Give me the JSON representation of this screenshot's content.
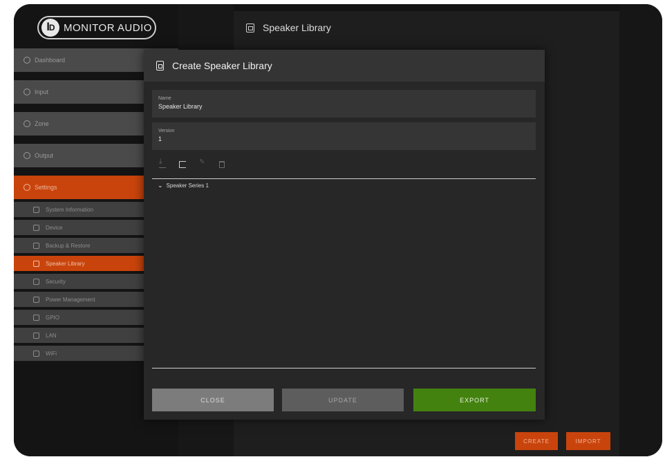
{
  "brand": {
    "logo_text": "MONITOR AUDIO",
    "accent_color": "#c9440c",
    "success_color": "#44820f"
  },
  "page_title": "Speaker Library",
  "nav": [
    {
      "label": "Dashboard",
      "icon": "dashboard-icon",
      "active": false
    },
    {
      "label": "Input",
      "icon": "input-icon",
      "active": false
    },
    {
      "label": "Zone",
      "icon": "zone-icon",
      "active": false
    },
    {
      "label": "Output",
      "icon": "output-icon",
      "active": false
    },
    {
      "label": "Settings",
      "icon": "settings-icon",
      "active": true
    }
  ],
  "settings_items": [
    {
      "label": "System Information",
      "icon": "info-icon",
      "active": false
    },
    {
      "label": "Device",
      "icon": "device-icon",
      "active": false
    },
    {
      "label": "Backup & Restore",
      "icon": "backup-icon",
      "active": false
    },
    {
      "label": "Speaker Library",
      "icon": "speaker-library-icon",
      "active": true
    },
    {
      "label": "Security",
      "icon": "security-icon",
      "active": false
    },
    {
      "label": "Power Management",
      "icon": "power-icon",
      "active": false
    },
    {
      "label": "GPIO",
      "icon": "gpio-icon",
      "active": false
    },
    {
      "label": "LAN",
      "icon": "lan-icon",
      "active": false
    },
    {
      "label": "WiFi",
      "icon": "wifi-icon",
      "active": false
    }
  ],
  "modal": {
    "title": "Create Speaker Library",
    "fields": {
      "name_label": "Name",
      "name_value": "Speaker Library",
      "version_label": "Version",
      "version_value": "1"
    },
    "toolbar": [
      "download-icon",
      "folder-icon",
      "edit-icon",
      "delete-icon"
    ],
    "tree": [
      {
        "label": "Speaker Series 1",
        "expanded": true
      }
    ],
    "buttons": {
      "close": "CLOSE",
      "update": "UPDATE",
      "export": "EXPORT"
    }
  },
  "footer_buttons": {
    "create": "CREATE",
    "import": "IMPORT"
  }
}
